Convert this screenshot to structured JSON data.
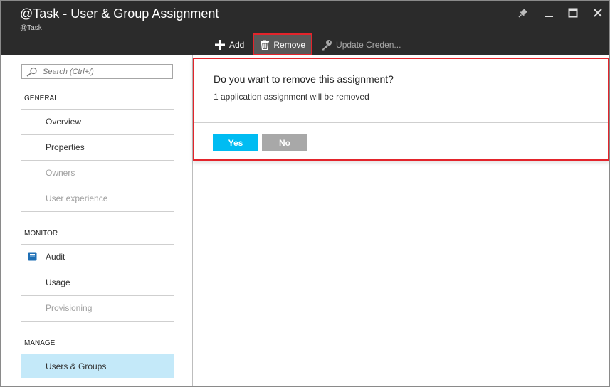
{
  "window": {
    "title": "@Task - User & Group Assignment",
    "subtitle": "@Task"
  },
  "toolbar": {
    "add_label": "Add",
    "remove_label": "Remove",
    "update_label": "Update Creden..."
  },
  "search": {
    "placeholder": "Search (Ctrl+/)"
  },
  "sidebar": {
    "general_header": "GENERAL",
    "monitor_header": "MONITOR",
    "manage_header": "MANAGE",
    "overview": "Overview",
    "properties": "Properties",
    "owners": "Owners",
    "user_experience": "User experience",
    "audit": "Audit",
    "usage": "Usage",
    "provisioning": "Provisioning",
    "users_groups": "Users & Groups"
  },
  "dialog": {
    "title": "Do you want to remove this assignment?",
    "message": "1 application assignment will be removed",
    "yes_label": "Yes",
    "no_label": "No"
  },
  "colors": {
    "titlebar": "#2b2b2b",
    "highlight_red": "#e3242b",
    "yes_button": "#00bcf2",
    "no_button": "#a8a8a8",
    "active_nav": "#c4e9f9"
  }
}
